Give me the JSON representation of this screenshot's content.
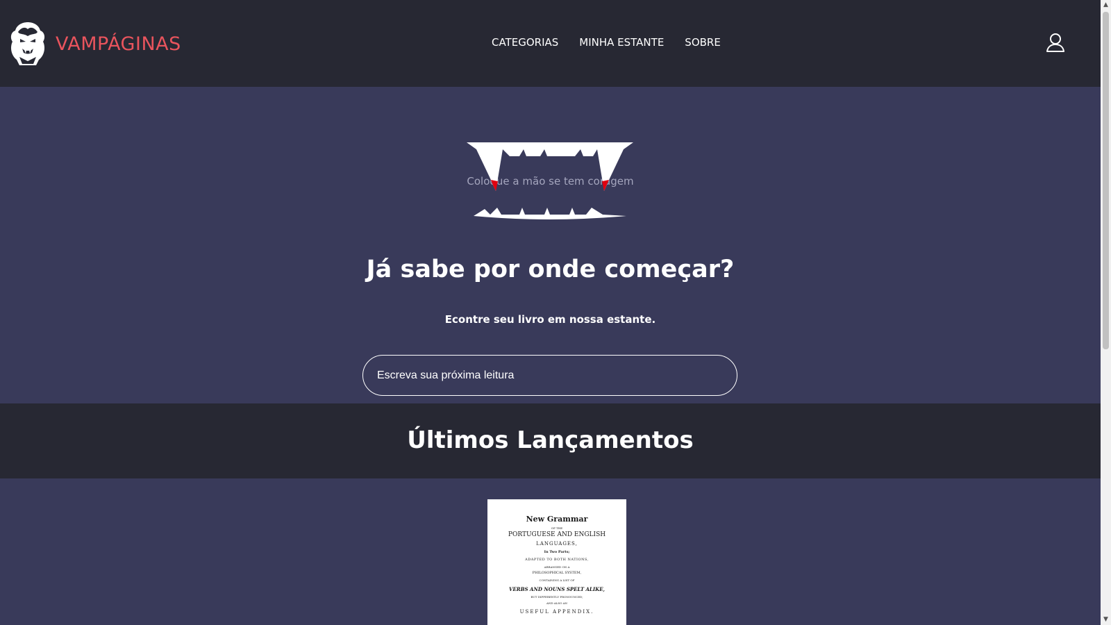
{
  "brand": {
    "name": "VAMPÁGINAS"
  },
  "nav": [
    {
      "label": "CATEGORIAS"
    },
    {
      "label": "MINHA ESTANTE"
    },
    {
      "label": "SOBRE"
    }
  ],
  "hero": {
    "fangs_caption": "Coloque a mão se tem coragem",
    "title": "Já sabe por onde começar?",
    "subtitle": "Econtre seu livro em nossa estante.",
    "search_placeholder": "Escreva sua próxima leitura"
  },
  "releases": {
    "title": "Últimos Lançamentos",
    "books": [
      {
        "cover_lines": [
          "New Grammar",
          "OF THE",
          "PORTUGUESE AND ENGLISH",
          "LANGUAGES,",
          "In Two Parts;",
          "ADAPTED TO BOTH NATIONS,",
          "ARRANGED ON A",
          "PHILOSOPHICAL SYSTEM,",
          "CONTAINING A LIST OF",
          "VERBS AND NOUNS SPELT ALIKE,",
          "BUT DIFFERENTLY PRONOUNCED;",
          "AND ALSO AN",
          "USEFUL APPENDIX."
        ]
      }
    ]
  },
  "colors": {
    "header_bg": "#272833",
    "page_bg": "#393a5a",
    "brand_red": "#e9545d",
    "blood_red": "#e0000f"
  }
}
